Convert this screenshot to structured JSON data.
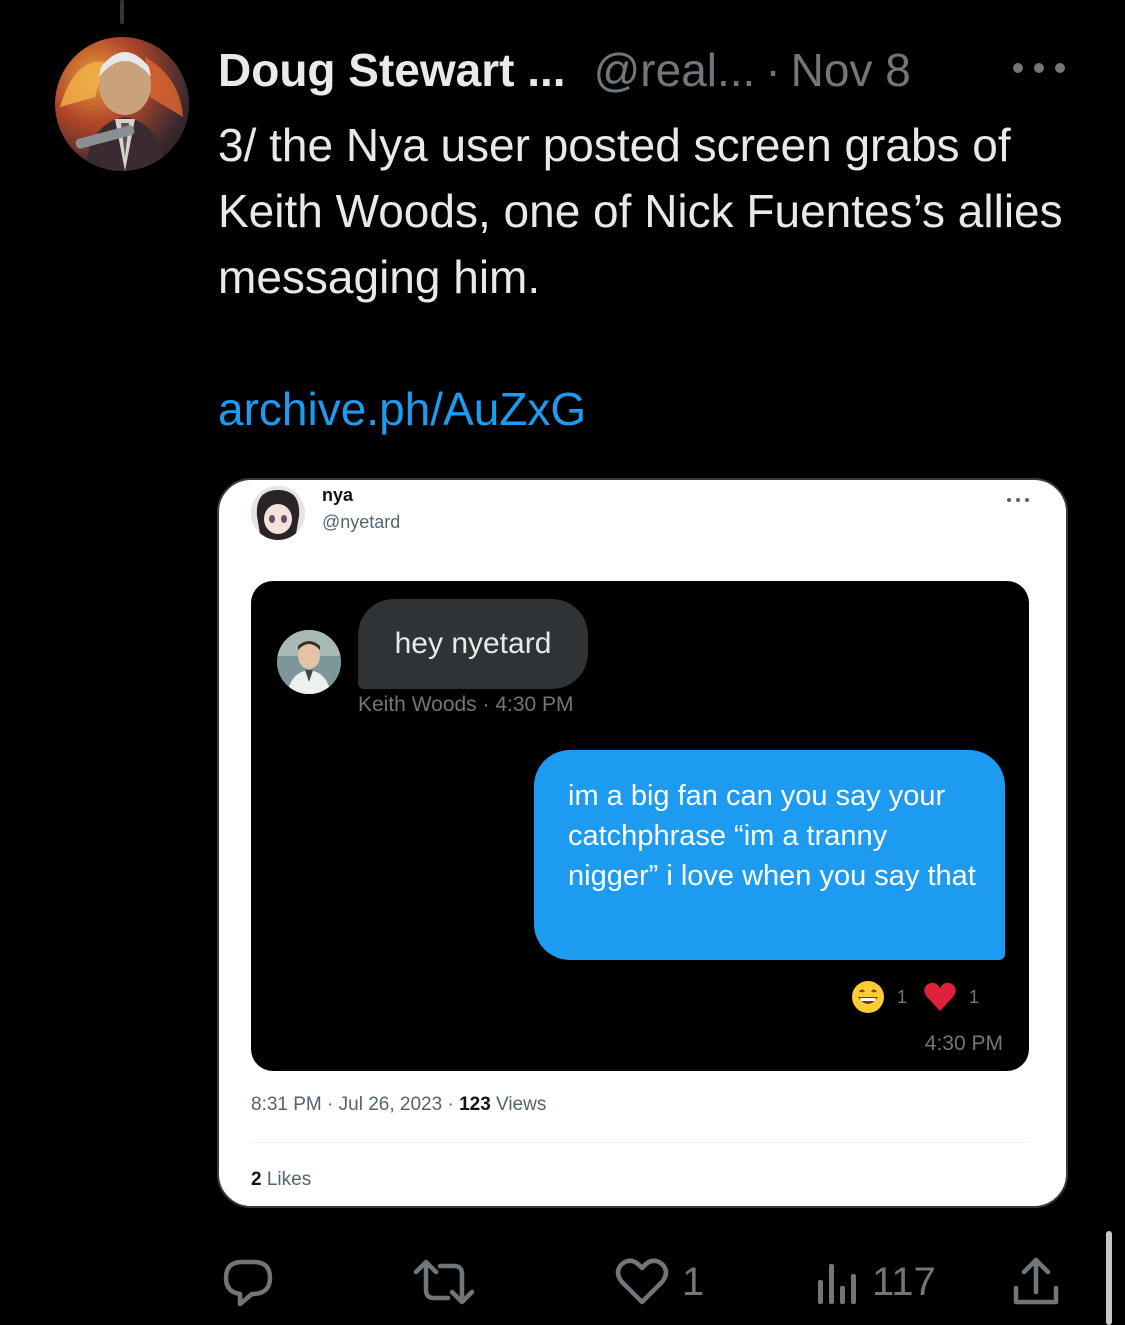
{
  "tweet": {
    "display_name": "Doug Stewart ...",
    "handle": "@real...",
    "separator": "·",
    "time": "Nov 8",
    "text": "3/ the Nya user posted screen grabs of Keith Woods, one of Nick Fuentes’s allies messaging him.",
    "link": "archive.ph/AuZxG"
  },
  "embedded": {
    "name": "nya",
    "handle": "@nyetard",
    "chat": {
      "incoming": {
        "text": "hey nyetard",
        "meta": "Keith Woods · 4:30 PM"
      },
      "outgoing": {
        "text": "im a big fan can you say your catchphrase “im a tranny nigger” i love when you say that",
        "time": "4:30 PM",
        "reactions": [
          {
            "emoji": "grinning-face-icon",
            "count": "1"
          },
          {
            "emoji": "heart-icon",
            "count": "1"
          }
        ]
      }
    },
    "timestamp": "8:31 PM · Jul 26, 2023 · ",
    "views_count": "123",
    "views_label": " Views",
    "likes_count": "2",
    "likes_label": " Likes"
  },
  "actions": {
    "reply_count": "",
    "repost_count": "",
    "like_count": "1",
    "views_count": "117"
  },
  "colors": {
    "background": "#000000",
    "link": "#1d9bf0",
    "muted": "#71767b",
    "bubble_outgoing": "#1d9bf0",
    "bubble_incoming": "#2f3336"
  }
}
